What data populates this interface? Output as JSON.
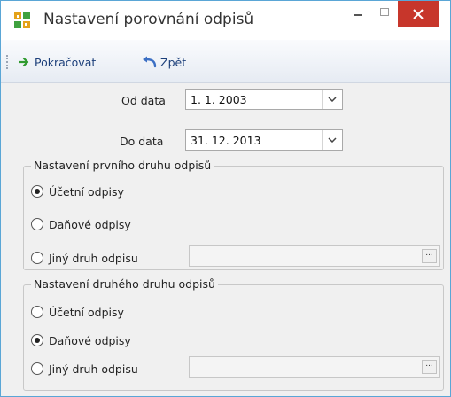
{
  "window": {
    "title": "Nastavení porovnání odpisů",
    "close_color": "#c7362b",
    "accent": "#5aa6d6"
  },
  "toolbar": {
    "continue_label": "Pokračovat",
    "back_label": "Zpět"
  },
  "dates": {
    "from_label": "Od data",
    "from_value": "1. 1. 2003",
    "to_label": "Do data",
    "to_value": "31. 12. 2013"
  },
  "group1": {
    "title": "Nastavení prvního druhu odpisů",
    "options": [
      "Účetní odpisy",
      "Daňové odpisy",
      "Jiný druh odpisu"
    ],
    "selected": "Účetní odpisy",
    "other_value": "",
    "ellipsis": "..."
  },
  "group2": {
    "title": "Nastavení druhého druhu odpisů",
    "options": [
      "Účetní odpisy",
      "Daňové odpisy",
      "Jiný druh odpisu"
    ],
    "selected": "Daňové odpisy",
    "other_value": "",
    "ellipsis": "..."
  },
  "icons": {
    "app": "app-blocks-icon",
    "continue": "arrow-right-icon",
    "back": "undo-arrow-icon",
    "dropdown": "chevron-down-icon",
    "minimize": "minimize-icon",
    "maximize": "maximize-icon",
    "close": "close-icon"
  }
}
